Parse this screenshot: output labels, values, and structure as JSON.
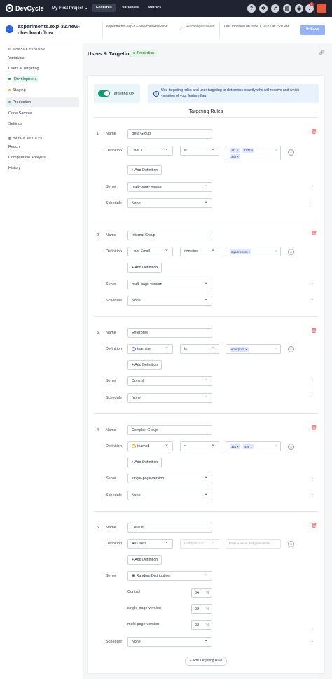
{
  "topbar": {
    "brand": "DevCycle",
    "project": "My First Project ⌄",
    "nav": [
      "Features",
      "Variables",
      "Metrics"
    ],
    "notification_count": "1"
  },
  "header": {
    "feature_title": "experiments.exp-32.new-checkout-flow",
    "feature_key": "experiments-exp-32-new-checkout-flow",
    "save_status": "All changes saved",
    "last_modified": "Last modified on June 1, 2023 at 2:20 PM",
    "save_button": "Save"
  },
  "sidebar": {
    "manage_heading": "MANAGE FEATURE",
    "variables": "Variables",
    "users_targeting": "Users & Targeting",
    "envs": [
      "Development",
      "Staging",
      "Production"
    ],
    "env_colors": [
      "#0e9f6e",
      "#f59e0b",
      "#10b981"
    ],
    "code_sample": "Code Sample",
    "settings": "Settings",
    "data_heading": "DATA & RESULTS",
    "reach": "Reach",
    "comparative": "Comparative Analysis",
    "history": "History"
  },
  "main": {
    "title": "Users & Targeting",
    "env_badge": "Production",
    "toggle_label": "Targeting ON",
    "info": "Use targeting rules and user targeting to determine exactly who will receive and which variation of your feature flag.",
    "rules_heading": "Targeting Rules",
    "labels": {
      "name": "Name",
      "definition": "Definition",
      "serve": "Serve",
      "schedule": "Schedule",
      "add_definition": "+ Add Definition"
    },
    "add_rule": "+ Add Targeting Rule"
  },
  "rules": [
    {
      "num": "1",
      "name": "Beta Group",
      "property": "User ID",
      "operator": "is",
      "values": [
        "111",
        "2222",
        "333"
      ],
      "serve": "multi-page-version",
      "schedule": "None"
    },
    {
      "num": "2",
      "name": "Internal Group",
      "property": "User Email",
      "operator": "contains",
      "values": [
        "mycorp.com"
      ],
      "serve": "multi-page-version",
      "schedule": "None"
    },
    {
      "num": "3",
      "name": "Enterprise",
      "property": "team.tier",
      "operator": "is",
      "values": [
        "enterprise"
      ],
      "serve": "Control",
      "schedule": "None"
    },
    {
      "num": "4",
      "name": "Complex Group",
      "property": "team.id",
      "operator": "=",
      "values": [
        "123",
        "456"
      ],
      "serve": "single-page-version",
      "schedule": "None"
    },
    {
      "num": "5",
      "name": "Default",
      "property": "All Users",
      "operator": "Comparator",
      "placeholder": "Enter a value and press enter...",
      "serve": "Random Distribution",
      "schedule": "None",
      "distribution": [
        {
          "label": "Control",
          "value": "34"
        },
        {
          "label": "single-page-version",
          "value": "33"
        },
        {
          "label": "multi-page-version",
          "value": "33"
        }
      ]
    }
  ],
  "percent": "%"
}
